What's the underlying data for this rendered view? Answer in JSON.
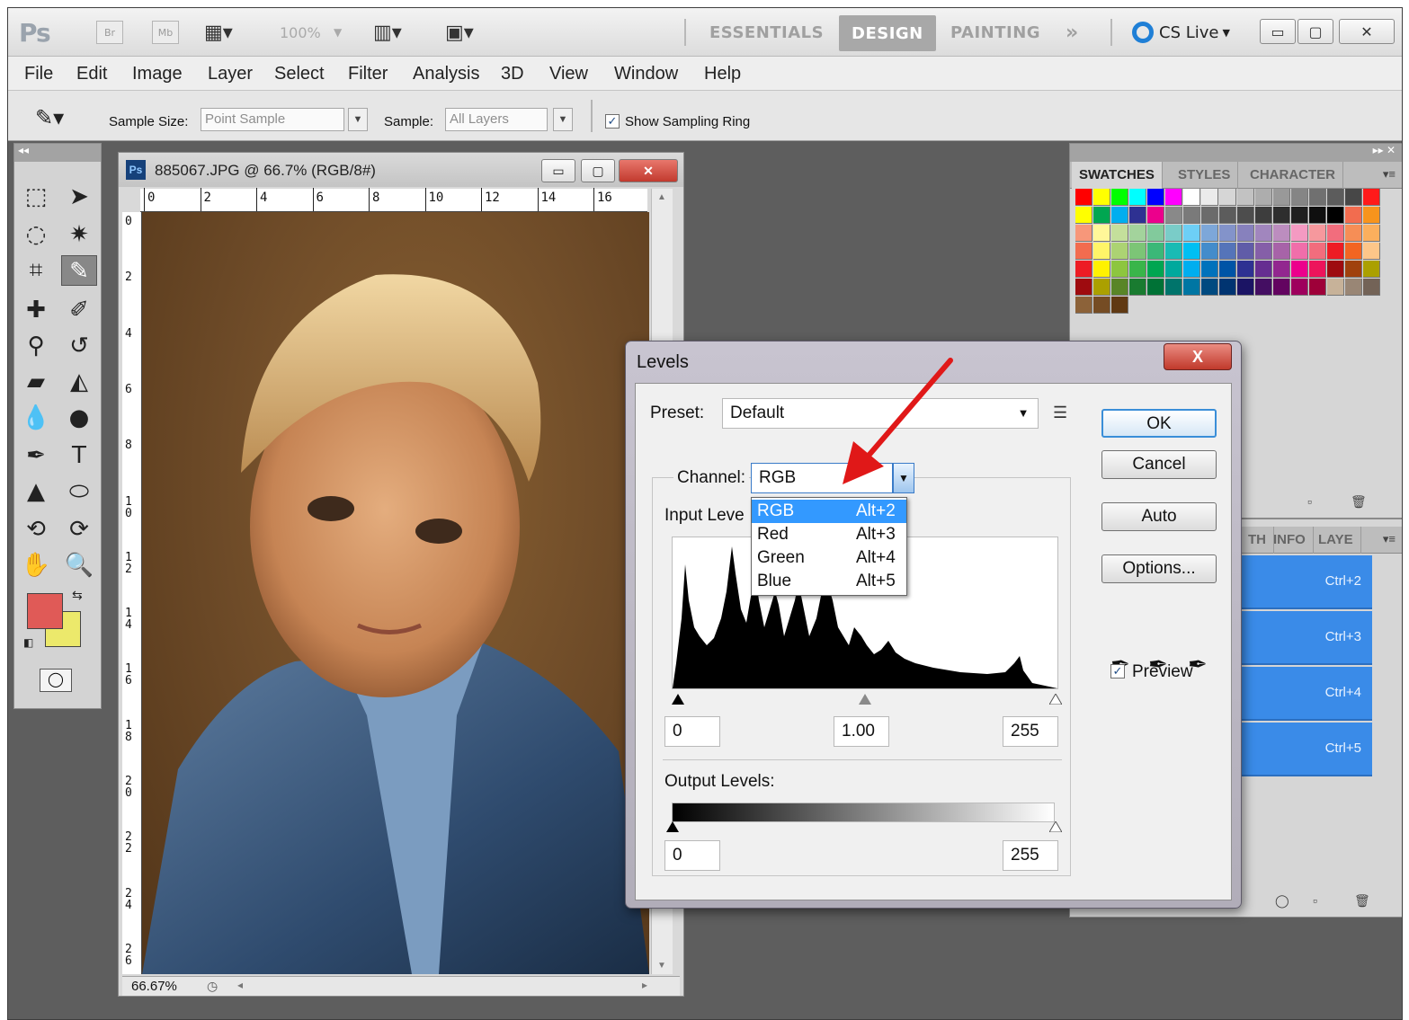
{
  "titlebar": {
    "app_logo": "Ps",
    "bridge": "Br",
    "mini_bridge": "Mb",
    "zoom": "100%",
    "workspaces": [
      "ESSENTIALS",
      "DESIGN",
      "PAINTING"
    ],
    "more": "»",
    "cs_live": "CS Live"
  },
  "menubar": [
    "File",
    "Edit",
    "Image",
    "Layer",
    "Select",
    "Filter",
    "Analysis",
    "3D",
    "View",
    "Window",
    "Help"
  ],
  "options": {
    "sample_size_label": "Sample Size:",
    "sample_size_value": "Point Sample",
    "sample_label": "Sample:",
    "sample_value": "All Layers",
    "ring_label": "Show Sampling Ring",
    "ring_checked": true
  },
  "document": {
    "ps_badge": "Ps",
    "title": "885067.JPG @ 66.7% (RGB/8#)",
    "ruler_h": [
      "0",
      "2",
      "4",
      "6",
      "8",
      "10",
      "12",
      "14",
      "16"
    ],
    "ruler_v": [
      "0",
      "2",
      "4",
      "6",
      "8",
      "10",
      "12",
      "14",
      "16",
      "18",
      "20",
      "22",
      "24",
      "26"
    ],
    "zoom_status": "66.67%"
  },
  "swatches": {
    "tabs": [
      "SWATCHES",
      "STYLES",
      "CHARACTER"
    ],
    "rows": [
      [
        "#ff0000",
        "#ffff00",
        "#00ff00",
        "#00ffff",
        "#0000ff",
        "#ff00ff",
        "#ffffff",
        "#ebebeb",
        "#d6d6d6",
        "#c2c2c2",
        "#adadad",
        "#999999",
        "#858585",
        "#707070",
        "#5c5c5c",
        "#474747",
        "#ff1a1a"
      ],
      [
        "#ffff00",
        "#00a651",
        "#00aeef",
        "#2e3192",
        "#ec008c",
        "#898989",
        "#7a7a7a",
        "#6b6b6b",
        "#5c5c5c",
        "#4d4d4d",
        "#3d3d3d",
        "#2e2e2e",
        "#1f1f1f",
        "#0f0f0f",
        "#000000",
        "#f26c4f",
        "#f7941d"
      ],
      [
        "#f7977a",
        "#fff799",
        "#c4df9b",
        "#a3d39c",
        "#82ca9c",
        "#7accc8",
        "#6dcff6",
        "#7da7d9",
        "#8393ca",
        "#8781bd",
        "#a186be",
        "#bc8dbf",
        "#f49ac2",
        "#f6989d",
        "#f26d7d",
        "#f68e56",
        "#fbaf5d"
      ],
      [
        "#f26c4f",
        "#fff568",
        "#acd373",
        "#7cc576",
        "#3bb878",
        "#1abbb4",
        "#00bff3",
        "#438ccb",
        "#5574b9",
        "#605ca8",
        "#855fa8",
        "#a763a8",
        "#f06eaa",
        "#f26d7d",
        "#ed1c24",
        "#f26522",
        "#fdc689"
      ],
      [
        "#ed1c24",
        "#fff200",
        "#8dc63f",
        "#39b54a",
        "#00a651",
        "#00a99d",
        "#00aeef",
        "#0072bc",
        "#0054a6",
        "#2e3192",
        "#662d91",
        "#92278f",
        "#ec008c",
        "#ed145b",
        "#9e0b0f",
        "#a0410d",
        "#aba000"
      ],
      [
        "#9e0b0f",
        "#aba000",
        "#598527",
        "#197b30",
        "#007236",
        "#00746b",
        "#0076a3",
        "#004a80",
        "#003471",
        "#1b1464",
        "#440e62",
        "#630460",
        "#9e005d",
        "#9e0039",
        "#c7b299",
        "#998675",
        "#736357"
      ],
      [
        "#8c6239",
        "#754c24",
        "#603913"
      ]
    ]
  },
  "histogram_panel": {
    "tabs": [
      "TH",
      "INFO",
      "LAYE"
    ],
    "shortcuts": [
      "Ctrl+2",
      "Ctrl+3",
      "Ctrl+4",
      "Ctrl+5"
    ]
  },
  "levels": {
    "title": "Levels",
    "close": "X",
    "preset_label": "Preset:",
    "preset_value": "Default",
    "channel_label": "Channel:",
    "channel_value": "RGB",
    "input_label": "Input Leve",
    "input_black": "0",
    "input_gamma": "1.00",
    "input_white": "255",
    "output_label": "Output Levels:",
    "output_black": "0",
    "output_white": "255",
    "buttons": {
      "ok": "OK",
      "cancel": "Cancel",
      "auto": "Auto",
      "options": "Options..."
    },
    "preview_label": "Preview",
    "preview_checked": true,
    "channel_options": [
      {
        "name": "RGB",
        "shortcut": "Alt+2"
      },
      {
        "name": "Red",
        "shortcut": "Alt+3"
      },
      {
        "name": "Green",
        "shortcut": "Alt+4"
      },
      {
        "name": "Blue",
        "shortcut": "Alt+5"
      }
    ]
  },
  "colors": {
    "foreground": "#e05a57",
    "background": "#ece96b",
    "highlight": "#3399ff",
    "annotation_arrow": "#e01818"
  }
}
